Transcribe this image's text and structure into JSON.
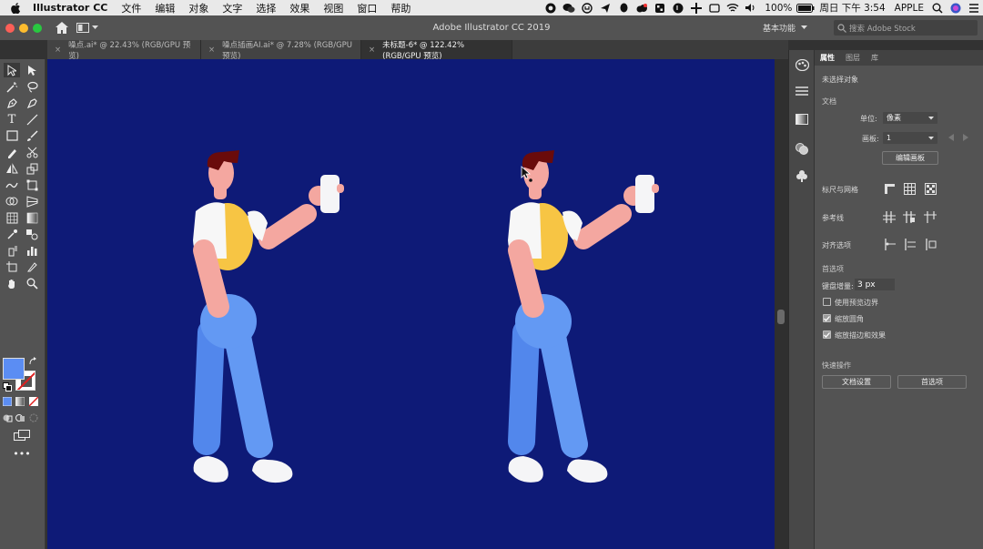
{
  "menubar": {
    "app_name": "Illustrator CC",
    "menus": [
      "文件",
      "编辑",
      "对象",
      "文字",
      "选择",
      "效果",
      "视图",
      "窗口",
      "帮助"
    ],
    "battery": "100%",
    "clock": "周日 下午 3:54",
    "user": "APPLE"
  },
  "appbar": {
    "title": "Adobe Illustrator CC 2019",
    "workspace": "基本功能",
    "search_placeholder": "搜索 Adobe Stock"
  },
  "tabs": [
    {
      "label": "噪点.ai* @ 22.43% (RGB/GPU 预览)"
    },
    {
      "label": "噪点插画AI.ai* @ 7.28% (RGB/GPU 预览)"
    },
    {
      "label": "未标题-6* @ 122.42% (RGB/GPU 预览)"
    }
  ],
  "colors": {
    "canvas": "#0e1a77",
    "fill": "#5b8df3",
    "skin": "#f4a7a0",
    "hair": "#6a0b0b",
    "backpack": "#f7c544",
    "pants": "#5b8df3",
    "shoe": "#f5f5f7"
  },
  "panel": {
    "tabs": [
      "属性",
      "图层",
      "库"
    ],
    "no_selection": "未选择对象",
    "document_section": "文档",
    "units_label": "单位:",
    "units_value": "像素",
    "artboard_label": "画板:",
    "artboard_value": "1",
    "edit_artboard_button": "编辑画板",
    "rulers_grids": "标尺与网格",
    "guides": "参考线",
    "snap_options": "对齐选项",
    "preferences_section": "首选项",
    "keyboard_increment_label": "键盘增量:",
    "keyboard_increment_value": "3 px",
    "check_preview_bounds": "使用预览边界",
    "check_scale_corners": "缩放圆角",
    "check_scale_strokes": "缩放描边和效果",
    "quick_actions": "快速操作",
    "doc_setup_button": "文档设置",
    "preferences_button": "首选项"
  }
}
